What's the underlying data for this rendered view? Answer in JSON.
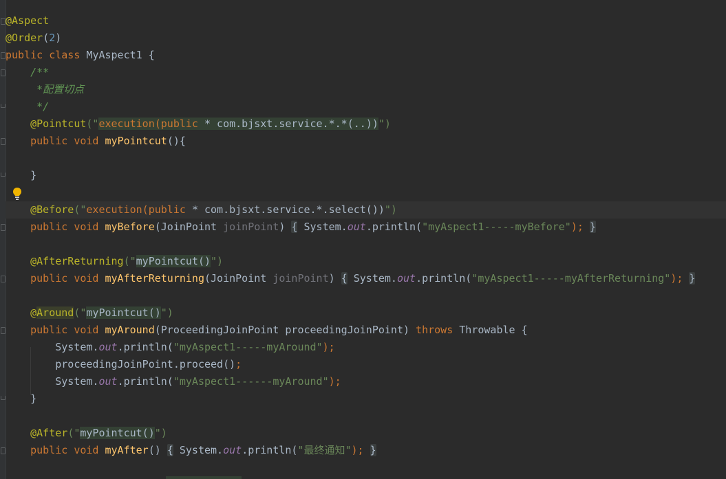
{
  "editor": {
    "language": "Java",
    "accent_colors": {
      "keyword": "#cc7832",
      "annotation": "#bbb529",
      "string": "#6a8759",
      "comment": "#629755",
      "number": "#6897bb",
      "method": "#ffc66d",
      "static_field": "#9876aa",
      "parameter": "#72737a",
      "background": "#2b2b2b"
    },
    "gutter_icons": [
      "lightbulb-icon",
      "fold-marker-icon"
    ],
    "lines": [
      {
        "tokens": [
          {
            "t": "@Aspect",
            "c": "an"
          }
        ]
      },
      {
        "tokens": [
          {
            "t": "@Order",
            "c": "an"
          },
          {
            "t": "(",
            "c": "pl"
          },
          {
            "t": "2",
            "c": "num"
          },
          {
            "t": ")",
            "c": "pl"
          }
        ]
      },
      {
        "tokens": [
          {
            "t": "public class ",
            "c": "kw"
          },
          {
            "t": "MyAspect1 {",
            "c": "pl"
          }
        ]
      },
      {
        "tokens": [
          {
            "t": "    "
          },
          {
            "t": "/**",
            "c": "cm"
          }
        ]
      },
      {
        "tokens": [
          {
            "t": "     "
          },
          {
            "t": "*配置切点",
            "c": "cm"
          }
        ]
      },
      {
        "tokens": [
          {
            "t": "     "
          },
          {
            "t": "*/",
            "c": "cm"
          }
        ]
      },
      {
        "tokens": [
          {
            "t": "    "
          },
          {
            "t": "@Pointcut",
            "c": "an"
          },
          {
            "t": "(\"",
            "c": "str"
          },
          {
            "t": "execution(",
            "c": "kw",
            "hl": "hl"
          },
          {
            "t": "public ",
            "c": "kw",
            "hl": "hl"
          },
          {
            "t": "* com.bjsxt.service.*.*(..))",
            "c": "pl",
            "hl": "hl"
          },
          {
            "t": "\")",
            "c": "str"
          }
        ]
      },
      {
        "tokens": [
          {
            "t": "    "
          },
          {
            "t": "public void ",
            "c": "kw"
          },
          {
            "t": "myPointcut",
            "c": "fn"
          },
          {
            "t": "(){",
            "c": "pl"
          }
        ]
      },
      {
        "tokens": [
          {
            "t": ""
          }
        ]
      },
      {
        "tokens": [
          {
            "t": "    }",
            "c": "pl"
          }
        ]
      },
      {
        "tokens": [
          {
            "t": ""
          }
        ]
      },
      {
        "tokens": [
          {
            "t": "    "
          },
          {
            "t": "@Before",
            "c": "an"
          },
          {
            "t": "(\"",
            "c": "str"
          },
          {
            "t": "execution(",
            "c": "kw"
          },
          {
            "t": "public ",
            "c": "kw"
          },
          {
            "t": "* com.bjsxt.service.*.select())",
            "c": "pl"
          },
          {
            "t": "\")",
            "c": "str"
          }
        ],
        "current": true
      },
      {
        "tokens": [
          {
            "t": "    "
          },
          {
            "t": "public void ",
            "c": "kw"
          },
          {
            "t": "myBefore",
            "c": "fn"
          },
          {
            "t": "(JoinPoint ",
            "c": "pl"
          },
          {
            "t": "joinPoint",
            "c": "par"
          },
          {
            "t": ") ",
            "c": "pl"
          },
          {
            "t": "{",
            "c": "pl",
            "hl": "bx"
          },
          {
            "t": " System.",
            "c": "pl"
          },
          {
            "t": "out",
            "c": "st"
          },
          {
            "t": ".println(",
            "c": "pl"
          },
          {
            "t": "\"myAspect1-----myBefore\"",
            "c": "str"
          },
          {
            "t": ");",
            "c": "kw"
          },
          {
            "t": " "
          },
          {
            "t": "}",
            "c": "pl",
            "hl": "bx"
          }
        ]
      },
      {
        "tokens": [
          {
            "t": ""
          }
        ]
      },
      {
        "tokens": [
          {
            "t": "    "
          },
          {
            "t": "@AfterReturning",
            "c": "an"
          },
          {
            "t": "(\"",
            "c": "str"
          },
          {
            "t": "myPointcut()",
            "c": "pl",
            "hl": "hl"
          },
          {
            "t": "\")",
            "c": "str"
          }
        ]
      },
      {
        "tokens": [
          {
            "t": "    "
          },
          {
            "t": "public void ",
            "c": "kw"
          },
          {
            "t": "myAfterReturning",
            "c": "fn"
          },
          {
            "t": "(JoinPoint ",
            "c": "pl"
          },
          {
            "t": "joinPoint",
            "c": "par"
          },
          {
            "t": ") ",
            "c": "pl"
          },
          {
            "t": "{",
            "c": "pl",
            "hl": "bx"
          },
          {
            "t": " System.",
            "c": "pl"
          },
          {
            "t": "out",
            "c": "st"
          },
          {
            "t": ".println(",
            "c": "pl"
          },
          {
            "t": "\"myAspect1-----myAfterReturning\"",
            "c": "str"
          },
          {
            "t": ");",
            "c": "kw"
          },
          {
            "t": " "
          },
          {
            "t": "}",
            "c": "pl",
            "hl": "bx"
          }
        ]
      },
      {
        "tokens": [
          {
            "t": ""
          }
        ]
      },
      {
        "tokens": [
          {
            "t": "    "
          },
          {
            "t": "@",
            "c": "an"
          },
          {
            "t": "Around",
            "c": "an",
            "hl": "hl2"
          },
          {
            "t": "(\"",
            "c": "str"
          },
          {
            "t": "myPointcut()",
            "c": "pl",
            "hl": "hl"
          },
          {
            "t": "\")",
            "c": "str"
          }
        ]
      },
      {
        "tokens": [
          {
            "t": "    "
          },
          {
            "t": "public void ",
            "c": "kw"
          },
          {
            "t": "myAround",
            "c": "fn"
          },
          {
            "t": "(ProceedingJoinPoint proceedingJoinPoint) ",
            "c": "pl"
          },
          {
            "t": "throws ",
            "c": "kw"
          },
          {
            "t": "Throwable {",
            "c": "pl"
          }
        ]
      },
      {
        "tokens": [
          {
            "t": "        System.",
            "c": "pl"
          },
          {
            "t": "out",
            "c": "st"
          },
          {
            "t": ".println(",
            "c": "pl"
          },
          {
            "t": "\"myAspect1-----myAround\"",
            "c": "str"
          },
          {
            "t": ");",
            "c": "kw"
          }
        ]
      },
      {
        "tokens": [
          {
            "t": "        proceedingJoinPoint.proceed()",
            "c": "pl"
          },
          {
            "t": ";",
            "c": "kw"
          }
        ]
      },
      {
        "tokens": [
          {
            "t": "        System.",
            "c": "pl"
          },
          {
            "t": "out",
            "c": "st"
          },
          {
            "t": ".println(",
            "c": "pl"
          },
          {
            "t": "\"myAspect1------myAround\"",
            "c": "str"
          },
          {
            "t": ");",
            "c": "kw"
          }
        ]
      },
      {
        "tokens": [
          {
            "t": "    }",
            "c": "pl"
          }
        ]
      },
      {
        "tokens": [
          {
            "t": ""
          }
        ]
      },
      {
        "tokens": [
          {
            "t": "    "
          },
          {
            "t": "@After",
            "c": "an"
          },
          {
            "t": "(\"",
            "c": "str"
          },
          {
            "t": "myPointcut()",
            "c": "pl",
            "hl": "hl"
          },
          {
            "t": "\")",
            "c": "str"
          }
        ]
      },
      {
        "tokens": [
          {
            "t": "    "
          },
          {
            "t": "public void ",
            "c": "kw"
          },
          {
            "t": "myAfter",
            "c": "fn"
          },
          {
            "t": "() ",
            "c": "pl"
          },
          {
            "t": "{",
            "c": "pl",
            "hl": "bx"
          },
          {
            "t": " System.",
            "c": "pl"
          },
          {
            "t": "out",
            "c": "st"
          },
          {
            "t": ".println(",
            "c": "pl"
          },
          {
            "t": "\"最终通知\"",
            "c": "str"
          },
          {
            "t": ");",
            "c": "kw"
          },
          {
            "t": " "
          },
          {
            "t": "}",
            "c": "pl",
            "hl": "bx"
          }
        ]
      }
    ]
  }
}
